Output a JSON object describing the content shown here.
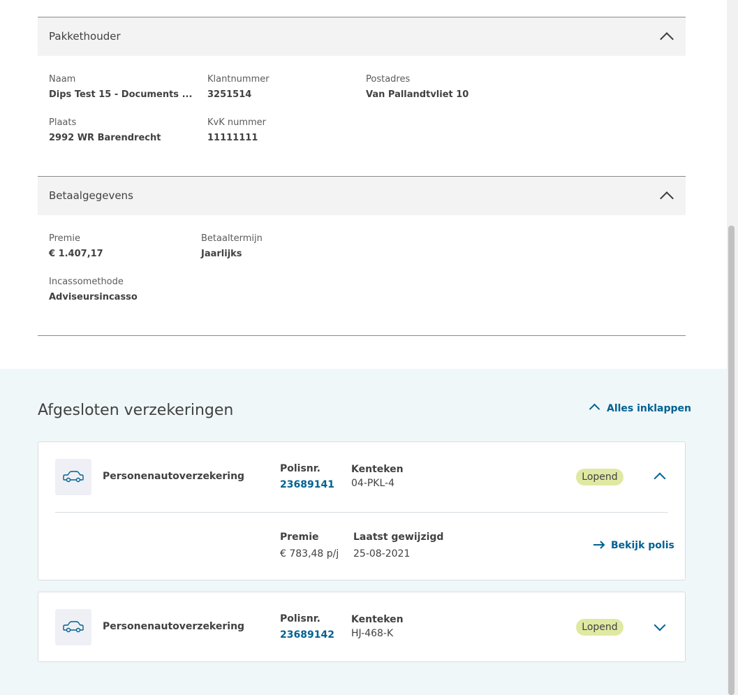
{
  "pakkethouder": {
    "title": "Pakkethouder",
    "naam_label": "Naam",
    "naam_value": "Dips Test 15 - Documents ...",
    "klantnummer_label": "Klantnummer",
    "klantnummer_value": "3251514",
    "postadres_label": "Postadres",
    "postadres_value": "Van Pallandtvliet 10",
    "plaats_label": "Plaats",
    "plaats_value": "2992 WR Barendrecht",
    "kvk_label": "KvK nummer",
    "kvk_value": "11111111"
  },
  "betaalgegevens": {
    "title": "Betaalgegevens",
    "premie_label": "Premie",
    "premie_value": "€ 1.407,17",
    "betaaltermijn_label": "Betaaltermijn",
    "betaaltermijn_value": "Jaarlijks",
    "incasso_label": "Incassomethode",
    "incasso_value": "Adviseursincasso"
  },
  "verzekeringen": {
    "heading": "Afgesloten verzekeringen",
    "collapse_all": "Alles inklappen",
    "cards": [
      {
        "product": "Personenautoverzekering",
        "polis_label": "Polisnr.",
        "polis_value": "23689141",
        "kenteken_label": "Kenteken",
        "kenteken_value": "04-PKL-4",
        "status": "Lopend",
        "premie_label": "Premie",
        "premie_value": "€ 783,48 p/j",
        "gewijzigd_label": "Laatst gewijzigd",
        "gewijzigd_value": "25-08-2021",
        "bekijk": "Bekijk polis"
      },
      {
        "product": "Personenautoverzekering",
        "polis_label": "Polisnr.",
        "polis_value": "23689142",
        "kenteken_label": "Kenteken",
        "kenteken_value": "HJ-468-K",
        "status": "Lopend"
      }
    ]
  },
  "icons": [
    "chevron-up-icon",
    "chevron-down-icon",
    "car-icon",
    "arrow-right-icon"
  ],
  "colors": {
    "link": "#006192",
    "badge": "#dfe9a2",
    "bottom_bg": "#f0f7f9",
    "section_header_bg": "#f3f3f3"
  }
}
